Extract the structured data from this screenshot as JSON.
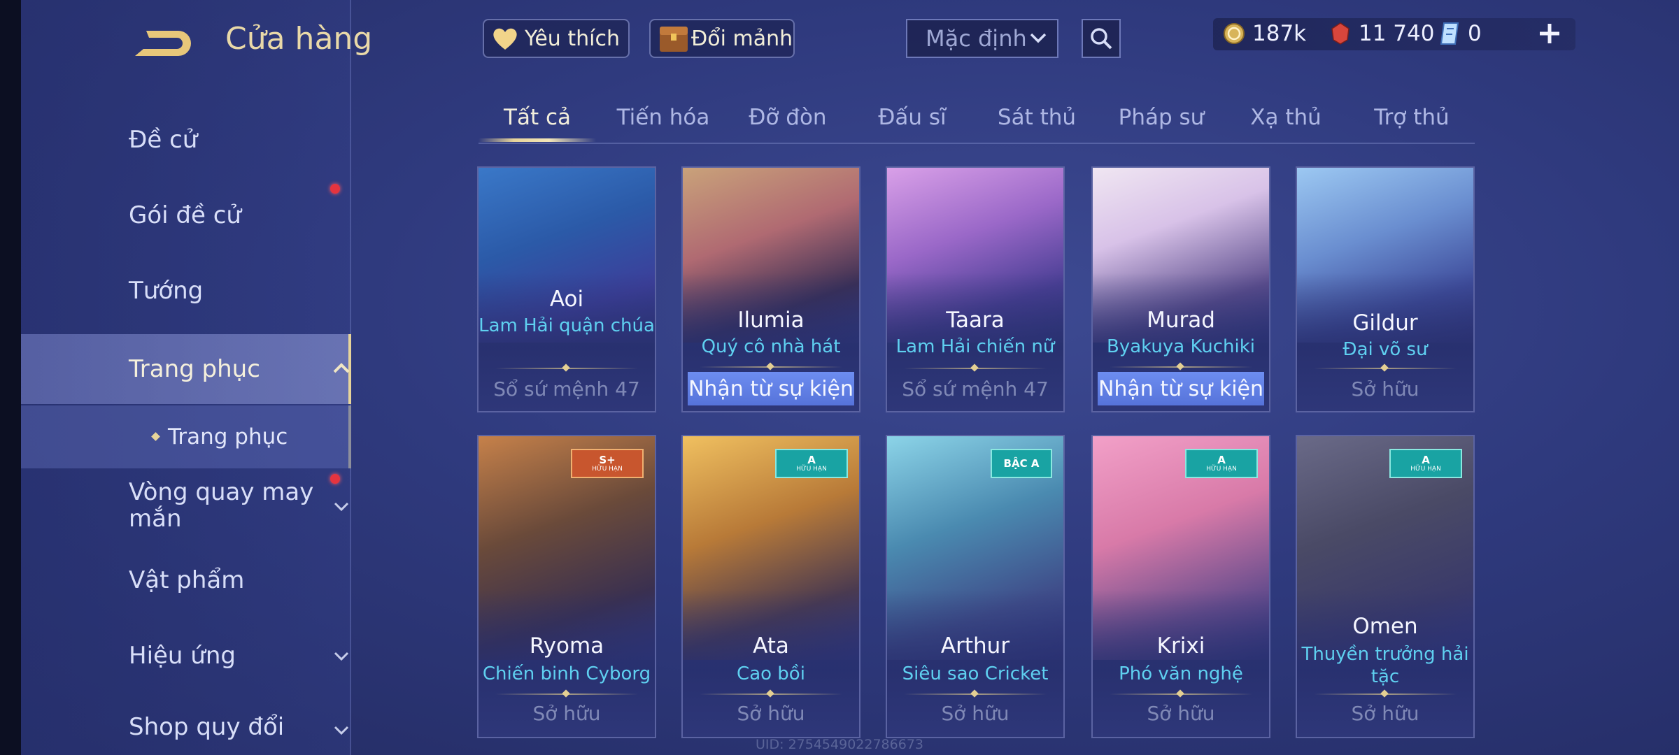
{
  "header": {
    "title": "Cửa hàng",
    "favorites_label": "Yêu thích",
    "exchange_label": "Đổi mảnh",
    "sort_value": "Mặc định"
  },
  "currency": {
    "gold": "187k",
    "vouchers": "11 740",
    "tickets": "0"
  },
  "sidebar": {
    "items": [
      {
        "label": "Đề cử"
      },
      {
        "label": "Gói đề cử"
      },
      {
        "label": "Tướng"
      },
      {
        "label": "Trang phục"
      },
      {
        "label": "Trang phục"
      },
      {
        "label": "Vòng quay may mắn"
      },
      {
        "label": "Vật phẩm"
      },
      {
        "label": "Hiệu ứng"
      },
      {
        "label": "Shop quy đổi"
      }
    ]
  },
  "tabs": [
    "Tất cả",
    "Tiến hóa",
    "Đỡ đòn",
    "Đấu sĩ",
    "Sát thủ",
    "Pháp sư",
    "Xạ thủ",
    "Trợ thủ"
  ],
  "cards": [
    {
      "hero": "Aoi",
      "skin": "Lam Hải quận chúa",
      "status": "Sổ sứ mệnh 47"
    },
    {
      "hero": "Ilumia",
      "skin": "Quý cô nhà hát",
      "status": "Nhận từ sự kiện"
    },
    {
      "hero": "Taara",
      "skin": "Lam Hải chiến nữ",
      "status": "Sổ sứ mệnh 47"
    },
    {
      "hero": "Murad",
      "skin": "Byakuya Kuchiki",
      "status": "Nhận từ sự kiện"
    },
    {
      "hero": "Gildur",
      "skin": "Đại võ sư",
      "status": "Sở hữu"
    },
    {
      "hero": "Ryoma",
      "skin": "Chiến binh Cyborg",
      "status": "Sở hữu",
      "badge": "S+",
      "badge_sub": "HỮU HẠN"
    },
    {
      "hero": "Ata",
      "skin": "Cao bồi",
      "status": "Sở hữu",
      "badge": "A",
      "badge_sub": "HỮU HẠN"
    },
    {
      "hero": "Arthur",
      "skin": "Siêu sao Cricket",
      "status": "Sở hữu",
      "badge": "BẬC A"
    },
    {
      "hero": "Krixi",
      "skin": "Phó văn nghệ",
      "status": "Sở hữu",
      "badge": "A",
      "badge_sub": "HỮU HẠN"
    },
    {
      "hero": "Omen",
      "skin": "Thuyền trưởng hải tặc",
      "status": "Sở hữu",
      "badge": "A",
      "badge_sub": "HỮU HẠN"
    }
  ],
  "uid": "UID: 2754549022786673",
  "colors": {
    "accent_gold": "#e7d49a",
    "skin_name": "#5fd0f0",
    "event_button": "#5f7fe6",
    "badge_red": "#c8562e",
    "badge_teal": "#19a3a3"
  },
  "icons": {
    "back": "back-arrow-icon",
    "heart": "heart-icon",
    "chest": "chest-icon",
    "search": "search-icon",
    "gold": "gold-coin-icon",
    "voucher": "voucher-gem-icon",
    "ticket": "ticket-icon",
    "plus": "plus-icon"
  }
}
